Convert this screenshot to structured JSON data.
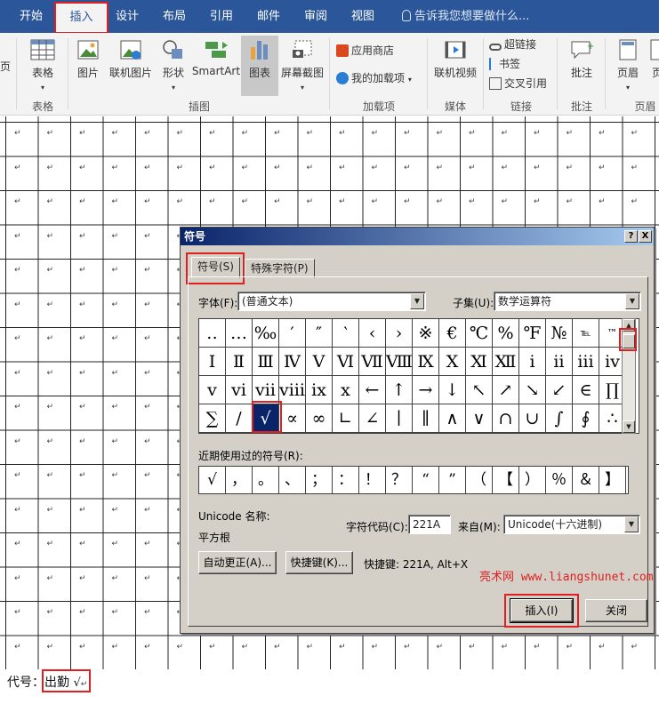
{
  "ribbon": {
    "tabs": [
      "开始",
      "插入",
      "设计",
      "布局",
      "引用",
      "邮件",
      "审阅",
      "视图"
    ],
    "active_tab": "插入",
    "tell_me": "告诉我您想要做什么...",
    "left_cut_label": "页",
    "buttons": {
      "table": "表格",
      "picture": "图片",
      "online_picture": "联机图片",
      "shapes": "形状",
      "smartart": "SmartArt",
      "chart": "图表",
      "screenshot": "屏幕截图",
      "store": "应用商店",
      "my_addins": "我的加载项",
      "online_video": "联机视频",
      "hyperlink": "超链接",
      "bookmark": "书签",
      "cross_ref": "交叉引用",
      "comment": "批注",
      "header": "页眉",
      "footer_cut": "页"
    },
    "groups": {
      "tables": "表格",
      "illustrations": "插图",
      "addins": "加载项",
      "media": "媒体",
      "links": "链接",
      "comments": "批注",
      "header_footer": "页眉"
    }
  },
  "document": {
    "paragraph_mark": "↵",
    "footer_label": "代号：",
    "footer_text": "出勤",
    "footer_symbol": "√"
  },
  "dialog": {
    "title": "符号",
    "help": "?",
    "close": "X",
    "tabs": [
      "符号(S)",
      "特殊字符(P)"
    ],
    "font_label": "字体(F):",
    "font_value": "(普通文本)",
    "subset_label": "子集(U):",
    "subset_value": "数学运算符",
    "symbols": [
      [
        "‥",
        "…",
        "‰",
        "′",
        "″",
        "‵",
        "‹",
        "›",
        "※",
        "€",
        "℃",
        "%",
        "℉",
        "№",
        "℡",
        "™"
      ],
      [
        "Ⅰ",
        "Ⅱ",
        "Ⅲ",
        "Ⅳ",
        "Ⅴ",
        "Ⅵ",
        "Ⅶ",
        "Ⅷ",
        "Ⅸ",
        "Ⅹ",
        "Ⅺ",
        "Ⅻ",
        "ⅰ",
        "ⅱ",
        "ⅲ",
        "ⅳ"
      ],
      [
        "ⅴ",
        "ⅵ",
        "ⅶ",
        "ⅷ",
        "ⅸ",
        "ⅹ",
        "←",
        "↑",
        "→",
        "↓",
        "↖",
        "↗",
        "↘",
        "↙",
        "∈",
        "∏"
      ],
      [
        "∑",
        "∕",
        "√",
        "∝",
        "∞",
        "∟",
        "∠",
        "∣",
        "∥",
        "∧",
        "∨",
        "∩",
        "∪",
        "∫",
        "∮",
        "∴"
      ]
    ],
    "selected_symbol": "√",
    "recent_label": "近期使用过的符号(R):",
    "recent": [
      "√",
      "，",
      "。",
      "、",
      "；",
      "：",
      "！",
      "？",
      "“",
      "”",
      "（",
      "【",
      "）",
      "％",
      "＆",
      "】"
    ],
    "unicode_name_label": "Unicode 名称:",
    "unicode_name": "平方根",
    "char_code_label": "字符代码(C):",
    "char_code": "221A",
    "from_label": "来自(M):",
    "from_value": "Unicode(十六进制)",
    "autocorrect": "自动更正(A)...",
    "shortcut_key": "快捷键(K)...",
    "shortcut_text": "快捷键: 221A, Alt+X",
    "watermark": "亮术网 www.liangshunet.com",
    "insert": "插入(I)",
    "close_button": "关闭"
  }
}
